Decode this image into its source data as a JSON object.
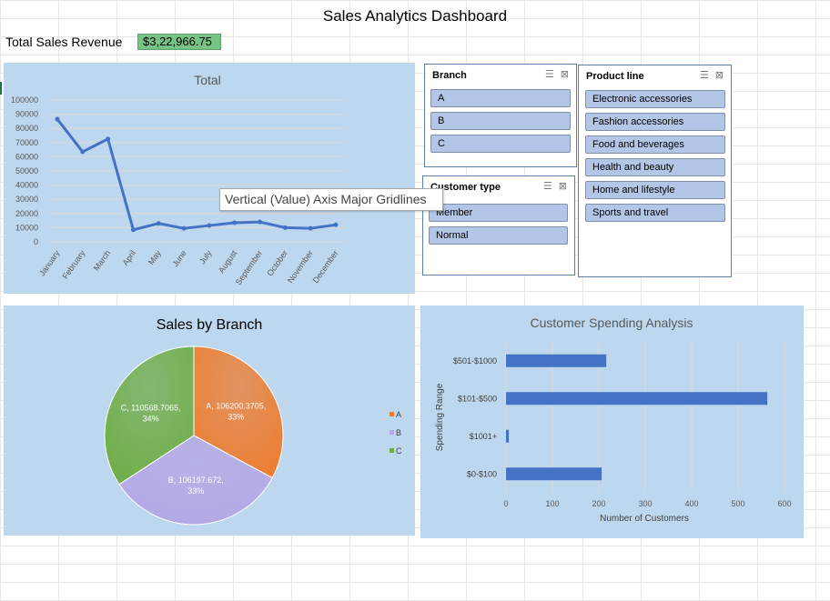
{
  "dashboard": {
    "title": "Sales Analytics Dashboard",
    "revenue_label": "Total Sales Revenue",
    "revenue_value": "$3,22,966.75"
  },
  "tooltip": {
    "text": "Vertical (Value) Axis Major Gridlines"
  },
  "slicers": {
    "branch": {
      "title": "Branch",
      "items": [
        "A",
        "B",
        "C"
      ]
    },
    "customer_type": {
      "title": "Customer type",
      "items": [
        "Member",
        "Normal"
      ]
    },
    "product_line": {
      "title": "Product line",
      "items": [
        "Electronic accessories",
        "Fashion accessories",
        "Food and beverages",
        "Health and beauty",
        "Home and lifestyle",
        "Sports and travel"
      ]
    }
  },
  "colors": {
    "panel": "#bdd7ee",
    "line": "#4472c4",
    "bar": "#4472c4",
    "pie_a": "#ed7d31",
    "pie_b": "#b4a7e5",
    "pie_c": "#70ad47"
  },
  "chart_data": [
    {
      "type": "line",
      "title": "Total",
      "categories": [
        "January",
        "February",
        "March",
        "April",
        "May",
        "June",
        "July",
        "August",
        "September",
        "October",
        "November",
        "December"
      ],
      "values": [
        86500,
        63500,
        72500,
        8500,
        13000,
        9500,
        11500,
        13500,
        14000,
        10000,
        9500,
        12000
      ],
      "ylim": [
        0,
        100000
      ],
      "yticks": [
        "0",
        "10000",
        "20000",
        "30000",
        "40000",
        "50000",
        "60000",
        "70000",
        "80000",
        "90000",
        "100000"
      ],
      "grid": true
    },
    {
      "type": "pie",
      "title": "Sales by Branch",
      "labels": [
        "A",
        "B",
        "C"
      ],
      "values": [
        106200.3705,
        106197.672,
        110568.7065
      ],
      "data_labels": [
        [
          "A, 106200.3705,",
          "33%"
        ],
        [
          "B, 106197.672,",
          "33%"
        ],
        [
          "C, 110568.7065,",
          "34%"
        ]
      ],
      "legend": "right"
    },
    {
      "type": "bar",
      "title": "Customer Spending Analysis",
      "categories": [
        "$501-$1000",
        "$101-$500",
        "$1001+",
        "$0-$100"
      ],
      "values": [
        216,
        563,
        6,
        206
      ],
      "xlabel": "Number of Customers",
      "ylabel": "Spending Range",
      "xlim": [
        0,
        600
      ],
      "xticks": [
        "0",
        "100",
        "200",
        "300",
        "400",
        "500",
        "600"
      ],
      "grid": true
    }
  ]
}
